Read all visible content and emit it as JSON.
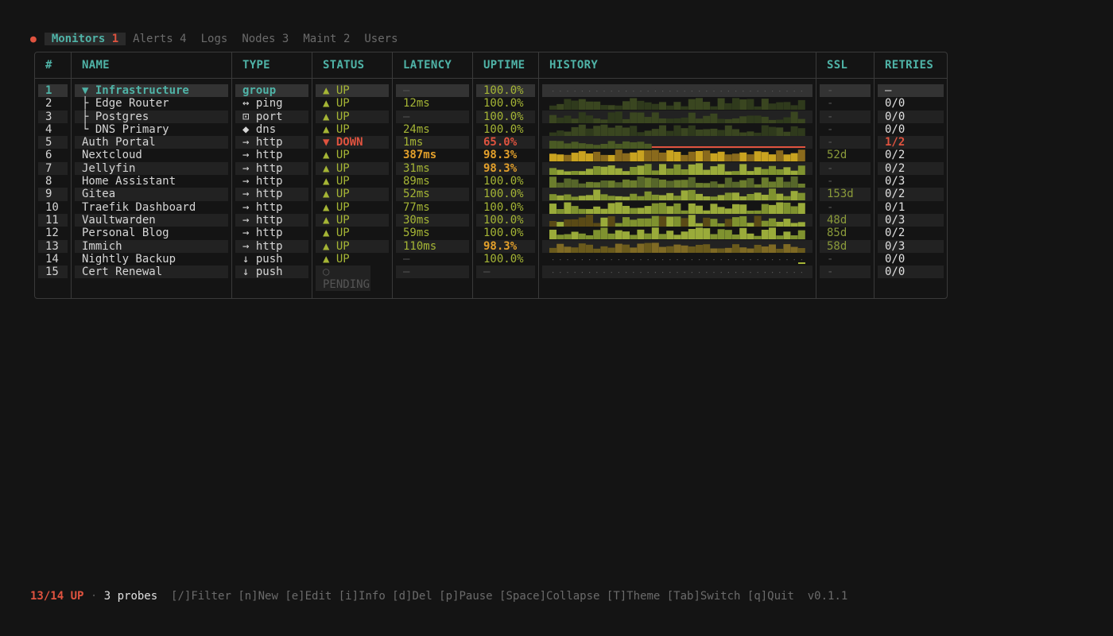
{
  "tabs": [
    {
      "label": "Monitors",
      "count": "1",
      "active": true
    },
    {
      "label": "Alerts",
      "count": "4",
      "active": false
    },
    {
      "label": "Logs",
      "count": "",
      "active": false
    },
    {
      "label": "Nodes",
      "count": "3",
      "active": false
    },
    {
      "label": "Maint",
      "count": "2",
      "active": false
    },
    {
      "label": "Users",
      "count": "",
      "active": false
    }
  ],
  "columns": {
    "num": "#",
    "name": "NAME",
    "type": "TYPE",
    "status": "STATUS",
    "latency": "LATENCY",
    "uptime": "UPTIME",
    "history": "HISTORY",
    "ssl": "SSL",
    "retries": "RETRIES"
  },
  "colors": {
    "accent": "#4fb3a7",
    "up": "#a5b535",
    "down": "#e0533f",
    "warn": "#e3a02b",
    "bg": "#141414"
  },
  "monitors": [
    {
      "num": "1",
      "name": "▼ Infrastructure",
      "type": "group",
      "status": "▲ UP",
      "status_kind": "up",
      "latency": "—",
      "lat_kind": "dim",
      "uptime": "100.0%",
      "up_kind": "ok",
      "ssl": "-",
      "retries": "—",
      "ret_kind": "dim",
      "group": true,
      "history": "dots"
    },
    {
      "num": "2",
      "name": "├ Edge Router",
      "type": "↔ ping",
      "status": "▲ UP",
      "status_kind": "up",
      "latency": "12ms",
      "lat_kind": "ok",
      "uptime": "100.0%",
      "up_kind": "ok",
      "ssl": "-",
      "retries": "0/0",
      "ret_kind": "",
      "history": "dark"
    },
    {
      "num": "3",
      "name": "├ Postgres",
      "type": "⊡ port",
      "status": "▲ UP",
      "status_kind": "up",
      "latency": "—",
      "lat_kind": "dim",
      "uptime": "100.0%",
      "up_kind": "ok",
      "ssl": "-",
      "retries": "0/0",
      "ret_kind": "",
      "history": "dark"
    },
    {
      "num": "4",
      "name": "└ DNS Primary",
      "type": "◆ dns",
      "status": "▲ UP",
      "status_kind": "up",
      "latency": "24ms",
      "lat_kind": "ok",
      "uptime": "100.0%",
      "up_kind": "ok",
      "ssl": "-",
      "retries": "0/0",
      "ret_kind": "",
      "history": "dark"
    },
    {
      "num": "5",
      "name": "Auth Portal",
      "type": "→ http",
      "status": "▼ DOWN",
      "status_kind": "down",
      "latency": "1ms",
      "lat_kind": "ok",
      "uptime": "65.0%",
      "up_kind": "bad",
      "ssl": "-",
      "retries": "1/2",
      "ret_kind": "bad",
      "history": "down"
    },
    {
      "num": "6",
      "name": "Nextcloud",
      "type": "→ http",
      "status": "▲ UP",
      "status_kind": "up",
      "latency": "387ms",
      "lat_kind": "warn",
      "uptime": "98.3%",
      "up_kind": "warn",
      "ssl": "52d",
      "retries": "0/2",
      "ret_kind": "",
      "history": "warn"
    },
    {
      "num": "7",
      "name": "Jellyfin",
      "type": "→ http",
      "status": "▲ UP",
      "status_kind": "up",
      "latency": "31ms",
      "lat_kind": "ok",
      "uptime": "98.3%",
      "up_kind": "warn",
      "ssl": "-",
      "retries": "0/2",
      "ret_kind": "",
      "history": "green"
    },
    {
      "num": "8",
      "name": "Home Assistant",
      "type": "→ http",
      "status": "▲ UP",
      "status_kind": "up",
      "latency": "89ms",
      "lat_kind": "ok",
      "uptime": "100.0%",
      "up_kind": "ok",
      "ssl": "-",
      "retries": "0/3",
      "ret_kind": "",
      "history": "olive"
    },
    {
      "num": "9",
      "name": "Gitea",
      "type": "→ http",
      "status": "▲ UP",
      "status_kind": "up",
      "latency": "52ms",
      "lat_kind": "ok",
      "uptime": "100.0%",
      "up_kind": "ok",
      "ssl": "153d",
      "retries": "0/2",
      "ret_kind": "",
      "history": "green"
    },
    {
      "num": "10",
      "name": "Traefik Dashboard",
      "type": "→ http",
      "status": "▲ UP",
      "status_kind": "up",
      "latency": "77ms",
      "lat_kind": "ok",
      "uptime": "100.0%",
      "up_kind": "ok",
      "ssl": "-",
      "retries": "0/1",
      "ret_kind": "",
      "history": "green"
    },
    {
      "num": "11",
      "name": "Vaultwarden",
      "type": "→ http",
      "status": "▲ UP",
      "status_kind": "up",
      "latency": "30ms",
      "lat_kind": "ok",
      "uptime": "100.0%",
      "up_kind": "ok",
      "ssl": "48d",
      "retries": "0/3",
      "ret_kind": "",
      "history": "mixed"
    },
    {
      "num": "12",
      "name": "Personal Blog",
      "type": "→ http",
      "status": "▲ UP",
      "status_kind": "up",
      "latency": "59ms",
      "lat_kind": "ok",
      "uptime": "100.0%",
      "up_kind": "ok",
      "ssl": "85d",
      "retries": "0/2",
      "ret_kind": "",
      "history": "green"
    },
    {
      "num": "13",
      "name": "Immich",
      "type": "→ http",
      "status": "▲ UP",
      "status_kind": "up",
      "latency": "110ms",
      "lat_kind": "ok",
      "uptime": "98.3%",
      "up_kind": "warn",
      "ssl": "58d",
      "retries": "0/3",
      "ret_kind": "",
      "history": "brown"
    },
    {
      "num": "14",
      "name": "Nightly Backup",
      "type": "↓ push",
      "status": "▲ UP",
      "status_kind": "up",
      "latency": "—",
      "lat_kind": "dim",
      "uptime": "100.0%",
      "up_kind": "ok",
      "ssl": "-",
      "retries": "0/0",
      "ret_kind": "",
      "history": "dots-tail"
    },
    {
      "num": "15",
      "name": "Cert Renewal",
      "type": "↓ push",
      "status": "○ PENDING",
      "status_kind": "pend",
      "latency": "—",
      "lat_kind": "dim",
      "uptime": "—",
      "up_kind": "dim",
      "ssl": "-",
      "retries": "0/0",
      "ret_kind": "",
      "history": "dots"
    }
  ],
  "footer": {
    "up_summary": "13/14 UP",
    "separator": " · ",
    "probes": "3 probes",
    "keys": "  [/]Filter [n]New [e]Edit [i]Info [d]Del [p]Pause [Space]Collapse [T]Theme [Tab]Switch [q]Quit  v0.1.1"
  }
}
